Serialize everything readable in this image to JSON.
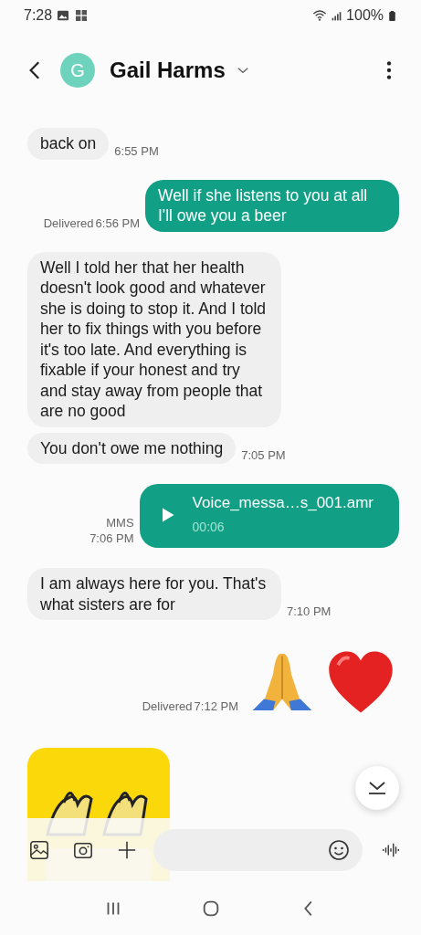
{
  "status_bar": {
    "time": "7:28",
    "battery": "100%"
  },
  "header": {
    "avatar_letter": "G",
    "contact_name": "Gail Harms"
  },
  "messages": [
    {
      "kind": "text",
      "outgoing": false,
      "text": "back on",
      "time": "6:55 PM"
    },
    {
      "kind": "text",
      "outgoing": true,
      "text": "Well if she listens to you at all I'll owe you a beer",
      "status": "Delivered",
      "time": "6:56 PM"
    },
    {
      "kind": "text",
      "outgoing": false,
      "text": "Well I told her that her health doesn't look good and whatever she is doing to stop it. And I told her to fix things with you before it's too late. And everything is fixable if your honest and try and stay away from people that are no good"
    },
    {
      "kind": "text",
      "outgoing": false,
      "text": "You don't owe me nothing",
      "time": "7:05 PM"
    },
    {
      "kind": "voice",
      "outgoing": true,
      "label": "MMS",
      "time": "7:06 PM",
      "file": "Voice_messa…s_001.amr",
      "duration": "00:06"
    },
    {
      "kind": "text",
      "outgoing": false,
      "text": "I am always here for you. That's what sisters are for",
      "time": "7:10 PM"
    },
    {
      "kind": "emoji",
      "outgoing": true,
      "status": "Delivered",
      "time": "7:12 PM"
    },
    {
      "kind": "picture",
      "outgoing": false
    }
  ]
}
